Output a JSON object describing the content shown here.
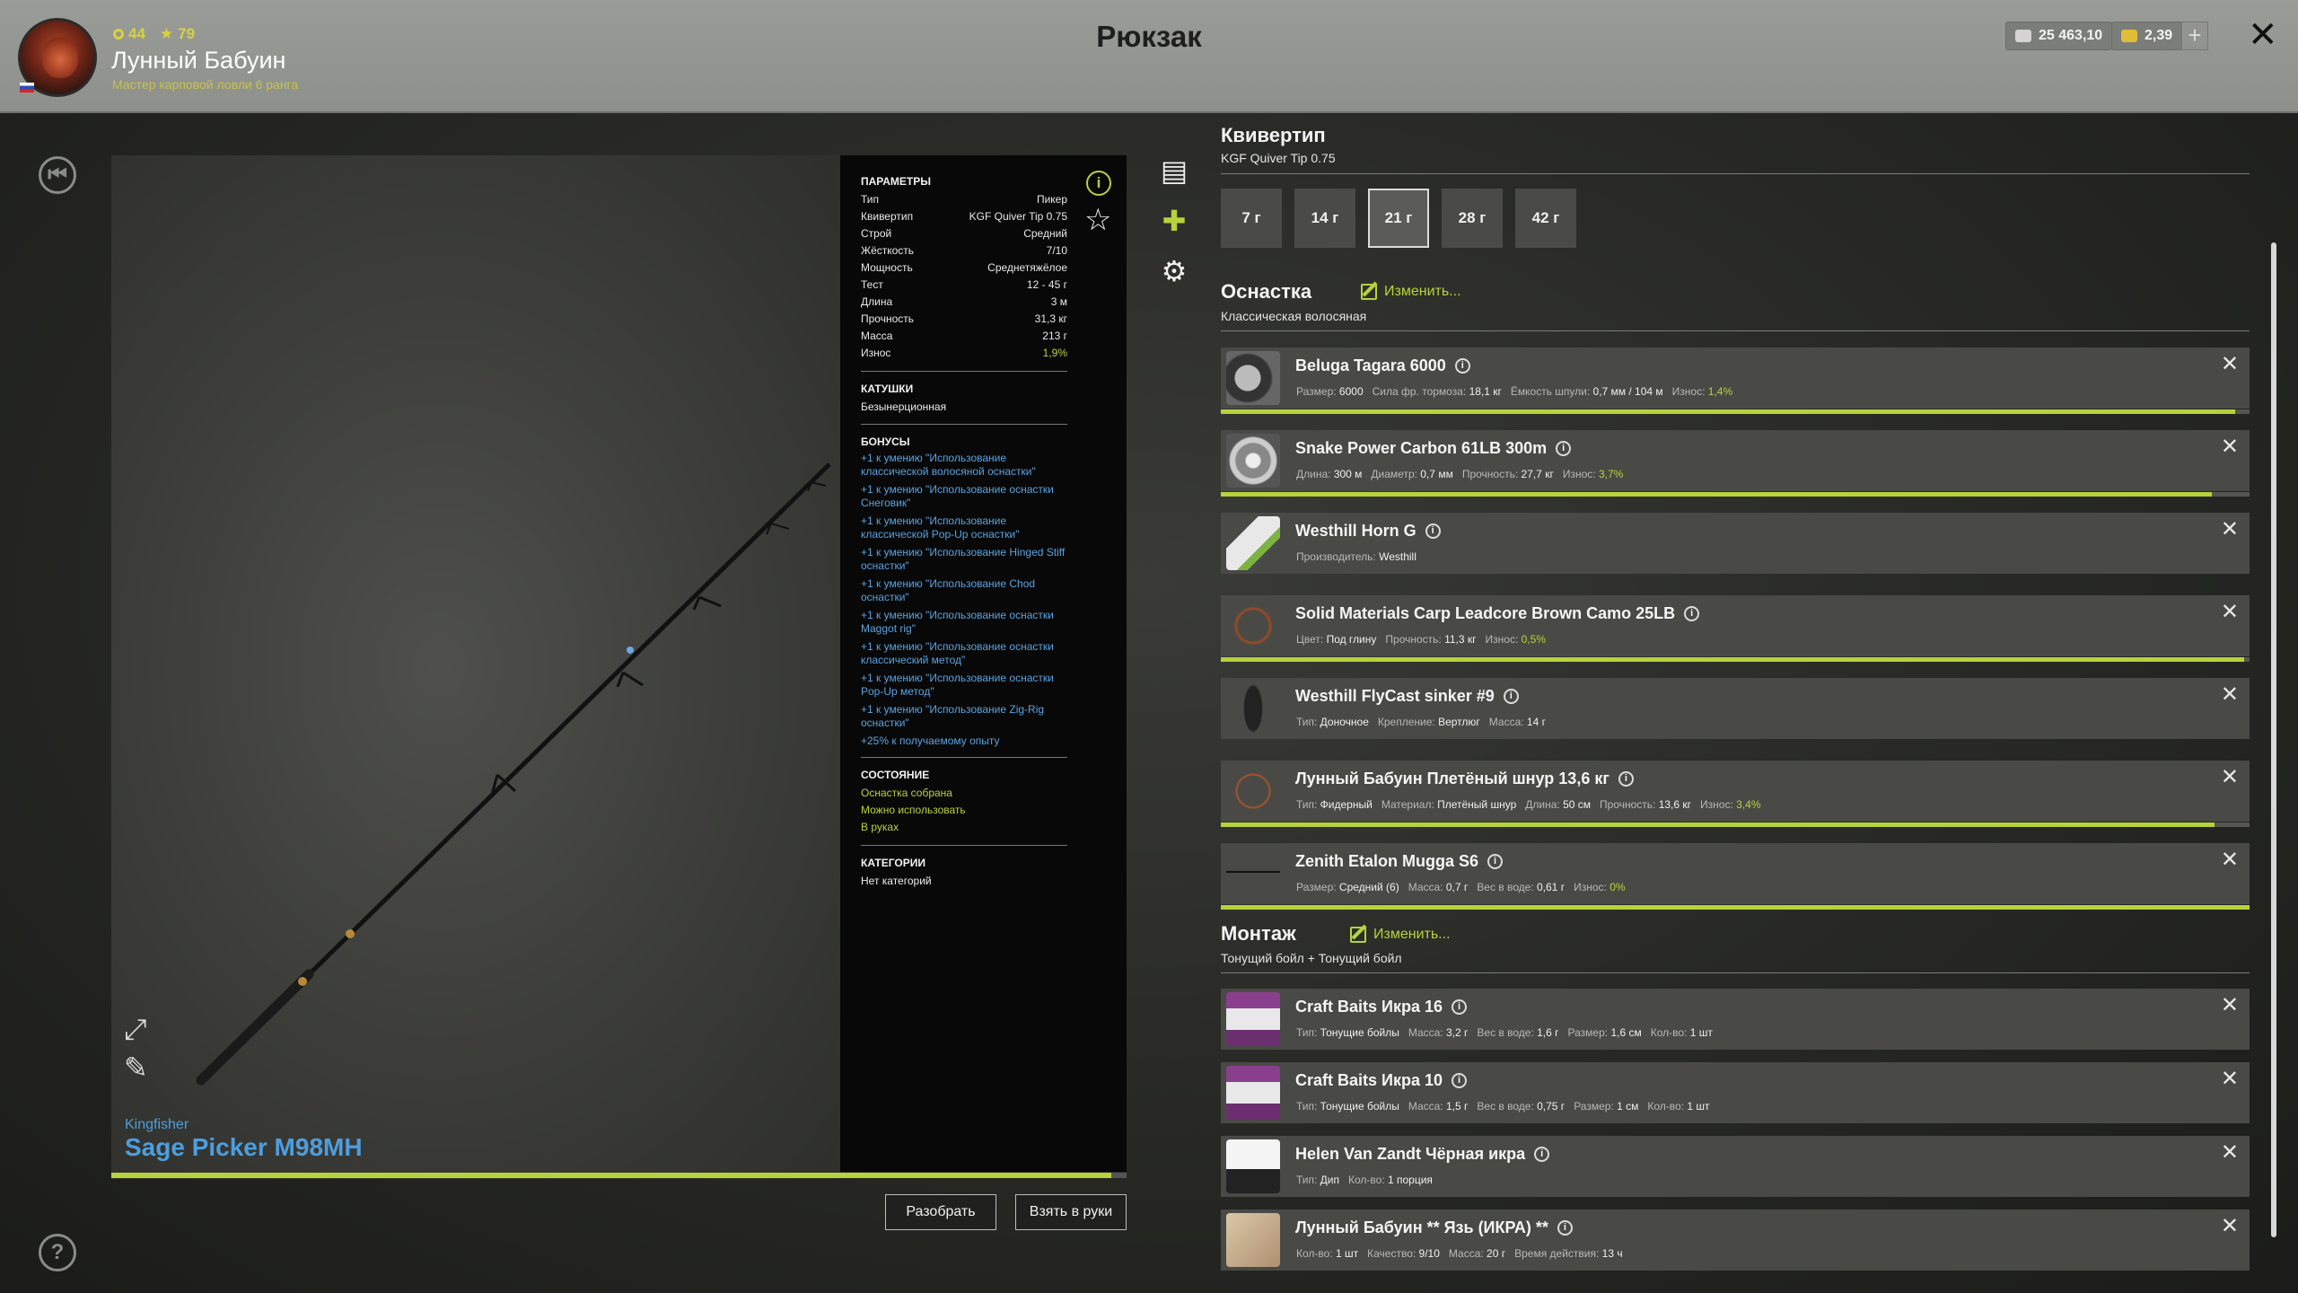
{
  "header": {
    "title": "Рюкзак",
    "player_name": "Лунный Бабуин",
    "player_rank": "Мастер карповой ловли 6 ранга",
    "stat_level": "44",
    "stat_rating": "79",
    "currency_silver": "25 463,10",
    "currency_gold": "2,39",
    "plus": "+",
    "close": "✕"
  },
  "rod": {
    "brand": "Kingfisher",
    "name": "Sage Picker M98MH",
    "wear_progress": 0.985
  },
  "params": {
    "section_params": "ПАРАМЕТРЫ",
    "rows": [
      {
        "label": "Тип",
        "value": "Пикер"
      },
      {
        "label": "Квивертип",
        "value": "KGF Quiver Tip 0.75"
      },
      {
        "label": "Строй",
        "value": "Средний"
      },
      {
        "label": "Жёсткость",
        "value": "7/10"
      },
      {
        "label": "Мощность",
        "value": "Среднетяжёлое"
      },
      {
        "label": "Тест",
        "value": "12 - 45 г"
      },
      {
        "label": "Длина",
        "value": "3 м"
      },
      {
        "label": "Прочность",
        "value": "31,3 кг"
      },
      {
        "label": "Масса",
        "value": "213 г"
      },
      {
        "label": "Износ",
        "value": "1,9%"
      }
    ],
    "section_reels": "КАТУШКИ",
    "reels": "Безынерционная",
    "section_bonuses": "БОНУСЫ",
    "bonuses": [
      "+1 к умению \"Использование классической волосяной оснастки\"",
      "+1 к умению \"Использование оснастки Снеговик\"",
      "+1 к умению \"Использование классической Pop-Up оснастки\"",
      "+1 к умению \"Использование Hinged Stiff оснастки\"",
      "+1 к умению \"Использование Chod оснастки\"",
      "+1 к умению \"Использование оснастки Maggot rig\"",
      "+1 к умению \"Использование оснастки классический метод\"",
      "+1 к умению \"Использование оснастки Pop-Up метод\"",
      "+1 к умению \"Использование Zig-Rig оснастки\"",
      "+25% к получаемому опыту"
    ],
    "section_state": "СОСТОЯНИЕ",
    "states": [
      "Оснастка собрана",
      "Можно использовать",
      "В руках"
    ],
    "section_categories": "КАТЕГОРИИ",
    "categories": "Нет категорий"
  },
  "actions": {
    "disassemble": "Разобрать",
    "take": "Взять в руки"
  },
  "quiver": {
    "title": "Квивертип",
    "subtitle": "KGF Quiver Tip 0.75",
    "weights": [
      "7 г",
      "14 г",
      "21 г",
      "28 г",
      "42 г"
    ],
    "selected": 2
  },
  "tackle": {
    "title": "Оснастка",
    "edit": "Изменить...",
    "subtitle": "Классическая волосяная",
    "items": [
      {
        "name": "Beluga Tagara 6000",
        "meta": [
          [
            "Размер:",
            "6000"
          ],
          [
            "Сила фр. тормоза:",
            "18,1 кг"
          ],
          [
            "Ёмкость шпули:",
            "0,7 мм / 104 м"
          ],
          [
            "Износ:",
            "1,4%"
          ]
        ],
        "bar": 0.986
      },
      {
        "name": "Snake Power Carbon 61LB 300m",
        "meta": [
          [
            "Длина:",
            "300 м"
          ],
          [
            "Диаметр:",
            "0,7 мм"
          ],
          [
            "Прочность:",
            "27,7 кг"
          ],
          [
            "Износ:",
            "3,7%"
          ]
        ],
        "bar": 0.963
      },
      {
        "name": "Westhill Horn G",
        "meta": [
          [
            "Производитель:",
            "Westhill"
          ]
        ],
        "bar": null
      },
      {
        "name": "Solid Materials Carp Leadcore Brown Camo 25LB",
        "meta": [
          [
            "Цвет:",
            "Под глину"
          ],
          [
            "Прочность:",
            "11,3 кг"
          ],
          [
            "Износ:",
            "0,5%"
          ]
        ],
        "bar": 0.995
      },
      {
        "name": "Westhill FlyCast sinker #9",
        "meta": [
          [
            "Тип:",
            "Доночное"
          ],
          [
            "Крепление:",
            "Вертлюг"
          ],
          [
            "Масса:",
            "14 г"
          ]
        ],
        "bar": null
      },
      {
        "name": "Лунный Бабуин Плетёный шнур 13,6 кг",
        "meta": [
          [
            "Тип:",
            "Фидерный"
          ],
          [
            "Материал:",
            "Плетёный шнур"
          ],
          [
            "Длина:",
            "50 см"
          ],
          [
            "Прочность:",
            "13,6 кг"
          ],
          [
            "Износ:",
            "3,4%"
          ]
        ],
        "bar": 0.966
      },
      {
        "name": "Zenith Etalon Mugga S6",
        "meta": [
          [
            "Размер:",
            "Средний (6)"
          ],
          [
            "Масса:",
            "0,7 г"
          ],
          [
            "Вес в воде:",
            "0,61 г"
          ],
          [
            "Износ:",
            "0%"
          ]
        ],
        "bar": 1.0
      }
    ]
  },
  "montage": {
    "title": "Монтаж",
    "edit": "Изменить...",
    "subtitle": "Тонущий бойл + Тонущий бойл",
    "items": [
      {
        "name": "Craft Baits Икра 16",
        "meta": [
          [
            "Тип:",
            "Тонущие бойлы"
          ],
          [
            "Масса:",
            "3,2 г"
          ],
          [
            "Вес в воде:",
            "1,6 г"
          ],
          [
            "Размер:",
            "1,6 см"
          ],
          [
            "Кол-во:",
            "1 шт"
          ]
        ]
      },
      {
        "name": "Craft Baits Икра 10",
        "meta": [
          [
            "Тип:",
            "Тонущие бойлы"
          ],
          [
            "Масса:",
            "1,5 г"
          ],
          [
            "Вес в воде:",
            "0,75 г"
          ],
          [
            "Размер:",
            "1 см"
          ],
          [
            "Кол-во:",
            "1 шт"
          ]
        ]
      },
      {
        "name": "Helen Van Zandt Чёрная икра",
        "meta": [
          [
            "Тип:",
            "Дип"
          ],
          [
            "Кол-во:",
            "1 порция"
          ]
        ]
      },
      {
        "name": "Лунный Бабуин ** Язь (ИКРА) **",
        "meta": [
          [
            "Кол-во:",
            "1 шт"
          ],
          [
            "Качество:",
            "9/10"
          ],
          [
            "Масса:",
            "20 г"
          ],
          [
            "Время действия:",
            "13 ч"
          ]
        ]
      }
    ]
  },
  "icons": {
    "back": "back-icon",
    "help": "help-icon",
    "expand": "expand-icon",
    "pencil": "pencil-icon",
    "list": "list-icon",
    "puzzle": "puzzle-icon",
    "gear": "gear-icon",
    "info": "info-icon",
    "star": "star-icon"
  },
  "colors": {
    "accent": "#b6d33b",
    "link": "#4d9ede",
    "header": "#9a9c98"
  }
}
